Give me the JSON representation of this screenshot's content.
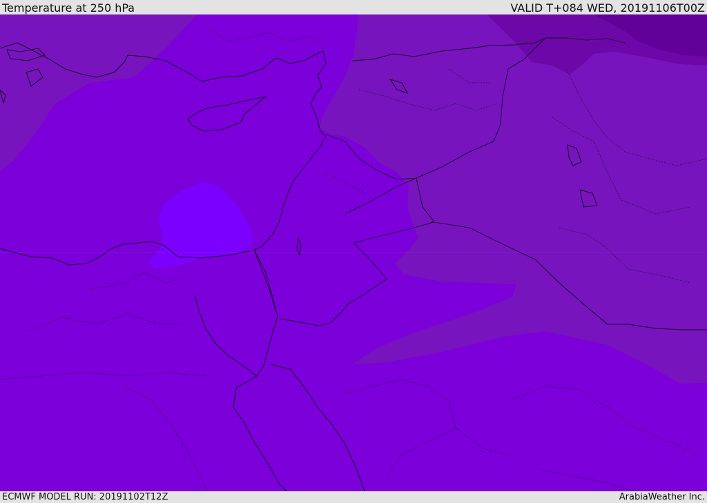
{
  "header": {
    "title": "Temperature at 250 hPa",
    "valid_time": "VALID T+084 WED, 20191106T00Z"
  },
  "footer": {
    "model_run": "ECMWF MODEL RUN: 20191102T12Z",
    "credit": "ArabiaWeather Inc."
  },
  "map": {
    "colors": {
      "base": "#7b00d9",
      "cold_band": "#7714bd",
      "colder_band": "#6d08a8",
      "coldest": "#62009a",
      "warm_pocket": "#7c00ff",
      "coastline": "#1a0a2a"
    }
  }
}
